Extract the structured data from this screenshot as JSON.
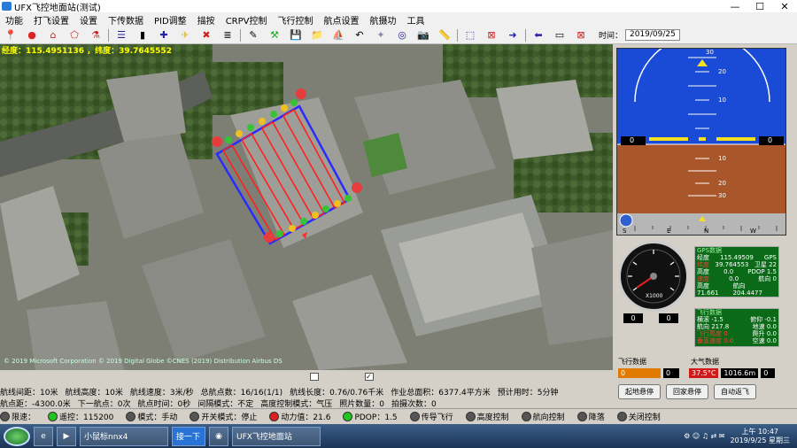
{
  "window": {
    "title": "UFX飞控地面站(测试)"
  },
  "menu": [
    "功能",
    "打飞设置",
    "设置",
    "下传数据",
    "PID调整",
    "描按",
    "CRPV控制",
    "飞行控制",
    "航点设置",
    "航摄功",
    "工具"
  ],
  "toolbar": {
    "time_label": "时间：",
    "time_value": "2019/09/25"
  },
  "map": {
    "coords": "经度：115.4951136 ，纬度：39.7645552",
    "copyright": "© 2019 Microsoft Corporation © 2019 Digital Globe ©CNES (2019) Distribution Airbus DS",
    "waypoint_labels": [
      "1",
      "2",
      "3",
      "4",
      "5",
      "6",
      "7",
      "8",
      "9",
      "10",
      "11",
      "12",
      "13",
      "14",
      "15",
      "16"
    ]
  },
  "hud": {
    "pitch_up": [
      "30",
      "20",
      "10"
    ],
    "pitch_down": [
      "10",
      "20",
      "30"
    ],
    "side_left": "0",
    "side_right": "0",
    "heading_ticks": [
      "S",
      "E",
      "N",
      "W"
    ]
  },
  "gps": {
    "title": "GPS数据",
    "rows": [
      [
        "经度",
        "115.49509",
        "GPS"
      ],
      [
        "纬度",
        "39.764553",
        "卫星 22"
      ],
      [
        "高度",
        "0.0",
        "PDOP 1.5"
      ],
      [
        "速度",
        "0.0",
        "航向 0"
      ],
      [
        "高度 71.661",
        "",
        "航向 204.4477"
      ]
    ]
  },
  "speedo": {
    "scale": [
      "0",
      "1",
      "2",
      "3",
      "4",
      "5",
      "6"
    ],
    "unit": "X1000",
    "readout_a": "0",
    "readout_b": "0"
  },
  "flight": {
    "title": "飞行数据",
    "rows": [
      [
        "横滚 -1.5",
        "俯仰 -0.1"
      ],
      [
        "航向 217.8",
        "地速 0.0"
      ],
      [
        "飞行高度 0",
        "爬升 0.0"
      ],
      [
        "垂直速度 0.0",
        "空速 0.0"
      ]
    ]
  },
  "wind": {
    "label1": "飞行数据",
    "label2": "大气数据",
    "v1": "0",
    "v2": "37.5°C",
    "v3": "1016.6m",
    "v4": "0"
  },
  "buttons": {
    "a": "起地悬停",
    "b": "回家悬停",
    "c": "自动返飞"
  },
  "status_rows": [
    [
      "航线间距：10米",
      "航线高度：10米",
      "航线速度：3米/秒",
      "总航点数：16/16(1/1)",
      "航线长度：0.76/0.76千米",
      "作业总面积：6377.4平方米",
      "预计用时：5分钟"
    ],
    [
      "航点距：-4300.0米",
      "下一航点：0次",
      "航点时间：0秒",
      "间隔模式：不定",
      "高度控制模式：气压",
      "照片数量：0",
      "拍摄次数：0"
    ]
  ],
  "indicators": [
    {
      "label": "限速：",
      "status": "off"
    },
    {
      "label": "遥控：115200",
      "status": "on"
    },
    {
      "label": "模式：手动",
      "status": "off"
    },
    {
      "label": "开关模式：停止",
      "status": "off"
    },
    {
      "label": "动力值：21.6",
      "status": "red"
    },
    {
      "label": "PDOP：1.5",
      "status": "on"
    },
    {
      "label": "传导飞行",
      "status": "off"
    },
    {
      "label": "高度控制",
      "status": "off"
    },
    {
      "label": "航向控制",
      "status": "off"
    },
    {
      "label": "降落",
      "status": "off"
    },
    {
      "label": "关闭控制",
      "status": "off"
    }
  ],
  "taskbar": {
    "item1": "小鼠标nnx4",
    "item2": "接一下",
    "item3": "UFX飞控地面站",
    "time": "上午 10:47",
    "date": "2019/9/25 星期三"
  }
}
